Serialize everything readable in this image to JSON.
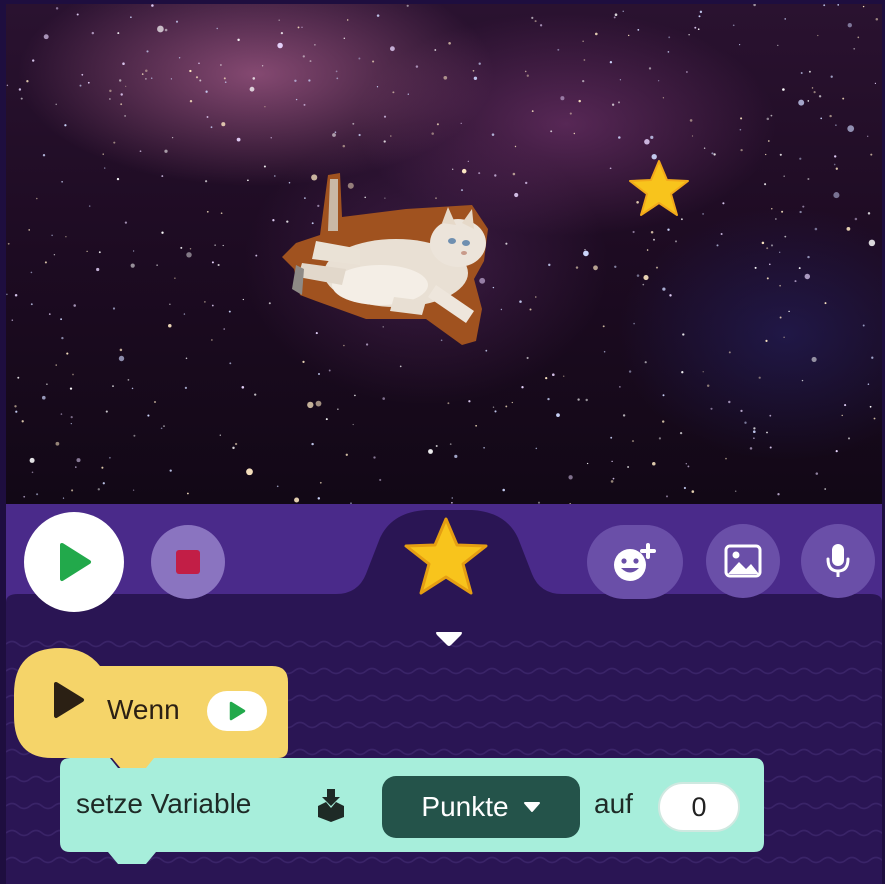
{
  "app": {
    "stage_sprites": [
      "cat-sprite",
      "star-sprite"
    ]
  },
  "toolbar": {
    "play_icon": "play-icon",
    "stop_icon": "stop-icon",
    "selected_sprite_icon": "star-icon",
    "add_sprite_icon": "add-sprite-icon",
    "background_icon": "image-icon",
    "sound_icon": "microphone-icon",
    "colors": {
      "bar": "#4a2a8a",
      "button": "#6a4fa8",
      "play": "#22a94b",
      "stop": "#c21e46",
      "star": "#f8c41c"
    }
  },
  "code": {
    "collapse_icon": "chevron-down-icon",
    "when_block": {
      "label": "Wenn",
      "color": "#f5d469",
      "chip_icon": "play-icon"
    },
    "set_var_block": {
      "label": "setze Variable",
      "icon": "variable-icon",
      "variable": "Punkte",
      "to_label": "auf",
      "value": "0",
      "color": "#a7eedb"
    }
  }
}
